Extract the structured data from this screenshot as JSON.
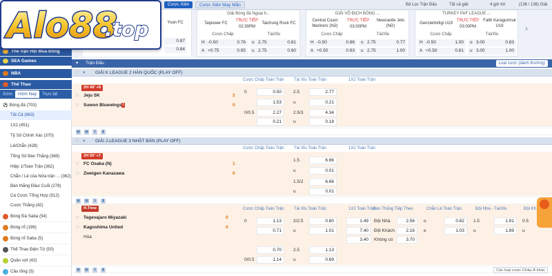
{
  "logo": {
    "text": "Alo88",
    "suffix": ".top"
  },
  "topbar": {
    "bet_parlay": "Cược Xiên",
    "lucky_parlay": "Cược Xiên May Mắn",
    "filter": "Bộ Lọc Trận Đấu",
    "all_leagues": "Tất cả giải",
    "hours": "4 giờ tới",
    "count": "(136 / 136) Giải"
  },
  "featured": [
    {
      "league": "",
      "team1": "",
      "team2": "Yuan FC",
      "status": "",
      "time": "",
      "ou_label": "",
      "rows": [
        {
          "a": "",
          "b": "0.87"
        },
        {
          "a": "",
          "b": "0.84"
        }
      ]
    },
    {
      "league": "Giải Bóng đá Ngoại h...",
      "team1": "Taipower FC",
      "team2": "Taichung Rock FC",
      "status": "TRỰC TIẾP",
      "time": "02:30PM",
      "hcap_label": "Cược Chấp",
      "ou_label": "Tài/Xỉu",
      "rows": [
        {
          "h": "H",
          "hv": "-0.50",
          "ho": "0.76",
          "o": "o",
          "ov": "2.75",
          "oo": "0.81"
        },
        {
          "h": "A",
          "hv": "+0.75",
          "ho": "0.95",
          "o": "u",
          "ov": "2.75",
          "oo": "0.90"
        }
      ]
    },
    {
      "league": "GIẢI VÔ ĐỊCH BÓNG ...",
      "team1": "Central Coast Mariners (Nữ)",
      "team2": "Newcastle Jets (Nữ)",
      "status": "TRỰC TIẾP",
      "time": "03:00PM",
      "hcap_label": "Cược Chấp",
      "ou_label": "Tài/Xỉu",
      "rows": [
        {
          "h": "H",
          "hv": "-0.50",
          "ho": "0.86",
          "o": "o",
          "ov": "2.75",
          "oo": "0.77"
        },
        {
          "h": "A",
          "hv": "+0.50",
          "ho": "0.93",
          "o": "u",
          "ov": "2.75",
          "oo": "1.00"
        }
      ]
    },
    {
      "league": "TURKEY PAF LEAGUE ...",
      "team1": "Genclerbirligi U19",
      "team2": "Fatih Karagumruk U19",
      "status": "TRỰC TIẾP",
      "time": "03:00PM",
      "hcap_label": "Cược Chấp",
      "ou_label": "Tài/Xỉu",
      "rows": [
        {
          "h": "H",
          "hv": "-0.50",
          "ho": "1.00",
          "o": "o",
          "ov": "3.00",
          "oo": "0.83"
        },
        {
          "h": "A",
          "hv": "+0.50",
          "ho": "0.81",
          "o": "u",
          "ov": "3.00",
          "oo": "1.00"
        }
      ]
    }
  ],
  "sidebar": {
    "winter_games": "Thế Vận Hội Mùa Đông",
    "sea_games": "SEA Games",
    "nba": "NBA",
    "sports": "Thể Thao",
    "tabs": [
      "Sớm",
      "Hôm Nay",
      "Trực tiế"
    ],
    "football": "Bóng đá (703)",
    "items": [
      "Tất Cả (663)",
      "1X2 (451)",
      "Tỷ Số Chính Xác (370)",
      "Lẻ/Chẵn (428)",
      "Tổng Số Bàn Thắng (369)",
      "Hiệp 1/Toàn Trận (362)",
      "Chẵn / Lẻ của Nửa trận ... (362)",
      "Bàn thắng Đầu/ Cuối (278)",
      "Cá Cược Tổng Hợp (512)",
      "Cược Thắng (42)"
    ],
    "sports_list": [
      {
        "label": "Bóng Đá Saba",
        "count": "(54)",
        "color": "#e05a2a"
      },
      {
        "label": "Bóng rổ",
        "count": "(196)",
        "color": "#e07a20"
      },
      {
        "label": "Bóng rổ Saba",
        "count": "(5)",
        "color": "#e07a20"
      },
      {
        "label": "Thể Thao Điện Tử",
        "count": "(50)",
        "color": "#555"
      },
      {
        "label": "Quần vợt",
        "count": "(42)",
        "color": "#b8d233"
      },
      {
        "label": "Cầu lông",
        "count": "(5)",
        "color": "#4ab0e0"
      }
    ]
  },
  "main": {
    "header": "Trận Đấu",
    "odds_type": "Loại cược (dành thường)",
    "col_hcap": "Cược Chấp Toàn Trận",
    "col_ou": "Tài Xỉu Toàn Trận",
    "col_1x2": "1X2 Toàn Trận",
    "col_ws": "Bàn Thắng Tiếp Theo",
    "col_oe": "Chẵn Lẻ Toàn Trận",
    "col_ho": "Đội Nhà - Tài/Xỉu",
    "col_last": "Đội Kh",
    "leagues": [
      {
        "name": "GIẢI K LEAGUE 2 HÀN QUỐC (PLAY OFF)",
        "live": "2H 49' +9",
        "team1": "Jeju SK",
        "team2": "Suwon Bluewings",
        "red": "1",
        "s1": "2",
        "s2": "0",
        "lines": [
          {
            "hv": "0",
            "ho": "0.50",
            "ov": "2.5",
            "oo": "2.77"
          },
          {
            "hv": "",
            "ho": "1.53",
            "ov": "u",
            "oo": "0.21"
          },
          {
            "hv": "0/0.5",
            "ho": "2.27",
            "ov": "2.5/3",
            "oo": "4.34"
          },
          {
            "hv": "",
            "ho": "0.21",
            "ov": "u",
            "oo": "0.18"
          }
        ]
      },
      {
        "name": "GIẢI J-LEAGUE 3 NHẬT BẢN (PLAY OFF)",
        "live": "2H 50' +7",
        "team1": "FC Osaka (N)",
        "team2": "Zweigen Kanazawa",
        "s1": "1",
        "s2": "0",
        "lines": [
          {
            "ov": "1.5",
            "oo": "6.66"
          },
          {
            "ov": "u",
            "oo": "0.01"
          },
          {
            "ov": "1.5/2",
            "oo": "6.66"
          },
          {
            "ov": "u",
            "oo": "0.01"
          }
        ]
      },
      {
        "name": "",
        "live": "H.Time",
        "team1": "Tegevajaro Miyazaki",
        "team2": "Kagoshima United",
        "draw": "Hòa",
        "s1": "0",
        "s2": "0",
        "lines": [
          {
            "hv": "0",
            "ho": "1.13",
            "ov": "2/2.5",
            "oo": "0.80",
            "x": "1.49",
            "ws": "Đội Nhà",
            "wso": "2.56",
            "oe": "o",
            "oeo": "0.82",
            "hov": "1.5",
            "hoo": "1.91",
            "lastv": "0.5"
          },
          {
            "hv": "",
            "ho": "0.71",
            "ov": "u",
            "oo": "1.01",
            "x": "7.40",
            "ws": "Đội Khách",
            "wso": "2.16",
            "oe": "e",
            "oeo": "1.03",
            "hov": "u",
            "hoo": "1.89",
            "lastv": "u"
          },
          {
            "x": "3.40",
            "ws": "Không có",
            "wso": "3.70"
          },
          {
            "ho": "0.70",
            "ov": "2.5",
            "oo": "1.13"
          },
          {
            "hv": "0/0.5",
            "ho": "1.14",
            "ov": "u",
            "oo": "0.69"
          }
        ]
      }
    ],
    "footer_select": "Các loại cược Châu Á khác"
  },
  "colors": {
    "brand": "#2a5aa3",
    "live": "#d23b2b",
    "row": "#fdf1e6"
  }
}
